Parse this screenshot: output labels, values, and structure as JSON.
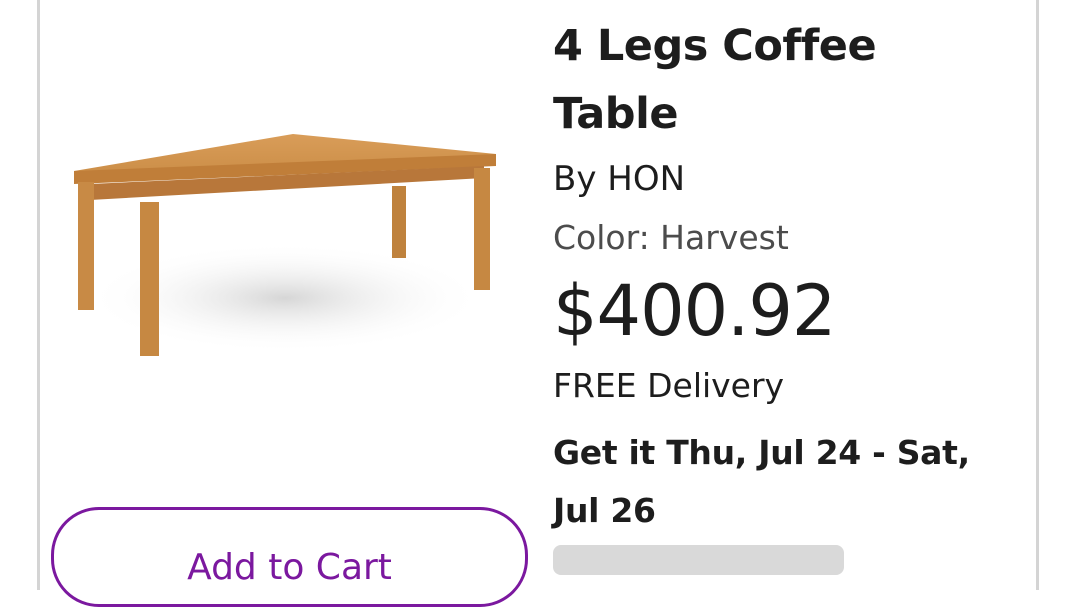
{
  "product": {
    "image_icon": "coffee-table-image",
    "title": "4 Legs Coffee Table",
    "brand": "By HON",
    "color": "Color: Harvest",
    "price": "$400.92",
    "delivery": "FREE Delivery",
    "eta": "Get it Thu, Jul 24 - Sat, Jul 26"
  },
  "actions": {
    "add_to_cart_label": "Add to Cart"
  },
  "colors": {
    "accent": "#7b189f",
    "border": "#d4d4d4",
    "wood": "#c98a43"
  }
}
